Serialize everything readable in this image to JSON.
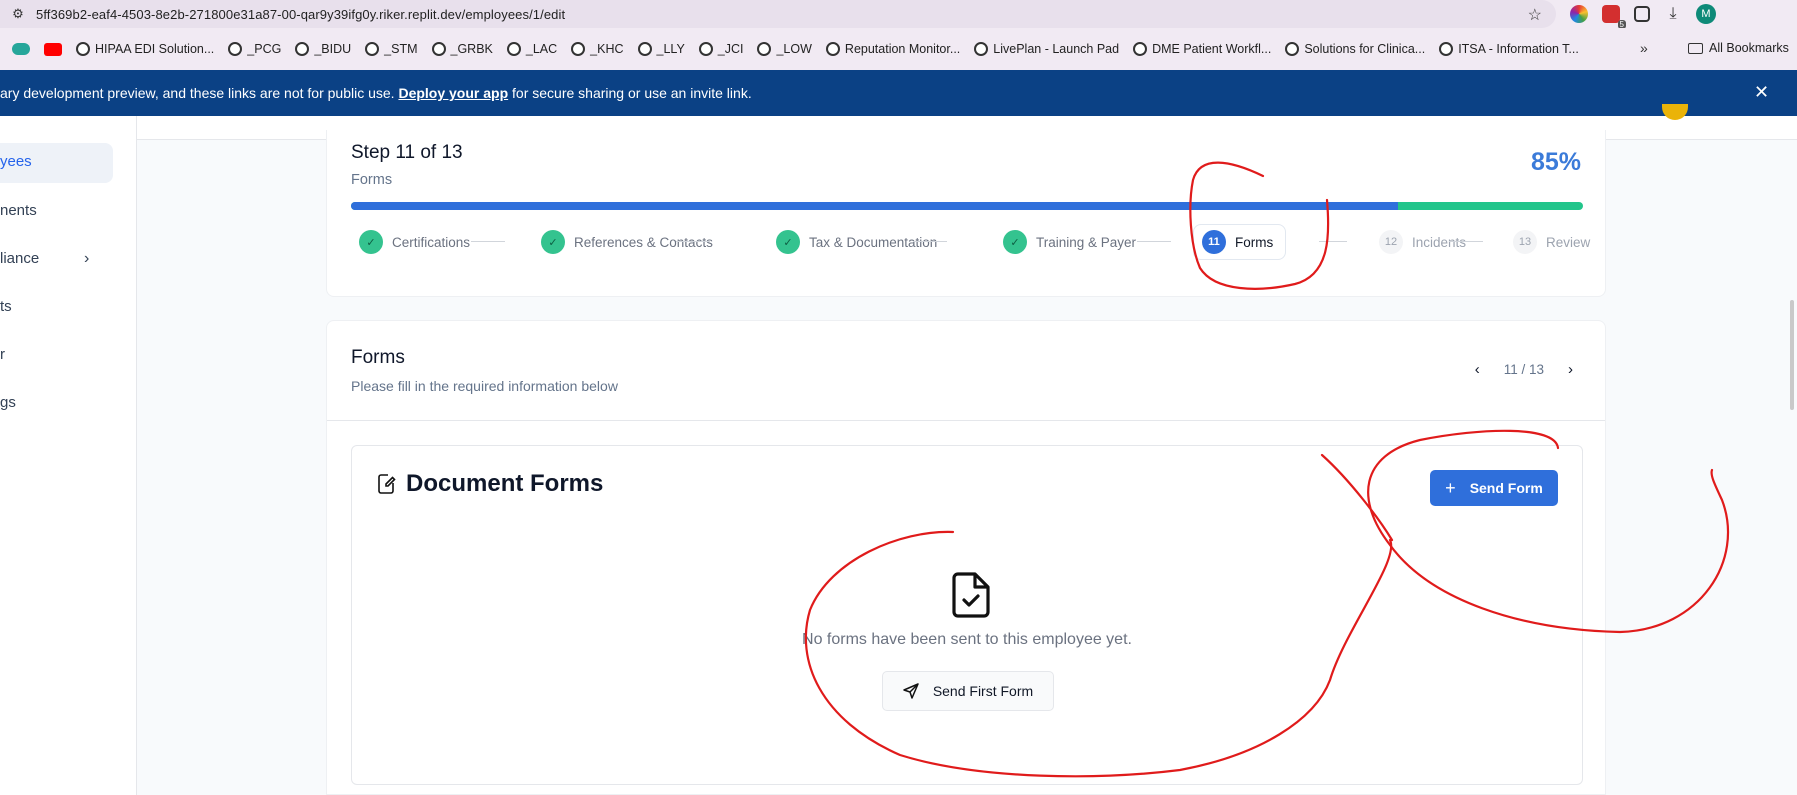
{
  "browser": {
    "url": "5ff369b2-eaf4-4503-8e2b-271800e31a87-00-qar9y39ifg0y.riker.replit.dev/employees/1/edit",
    "profile_initial": "M",
    "extension_badge": "5",
    "bookmarks": [
      {
        "label": "HIPAA EDI Solution..."
      },
      {
        "label": "_PCG"
      },
      {
        "label": "_BIDU"
      },
      {
        "label": "_STM"
      },
      {
        "label": "_GRBK"
      },
      {
        "label": "_LAC"
      },
      {
        "label": "_KHC"
      },
      {
        "label": "_LLY"
      },
      {
        "label": "_JCI"
      },
      {
        "label": "_LOW"
      },
      {
        "label": "Reputation Monitor..."
      },
      {
        "label": "LivePlan - Launch Pad"
      },
      {
        "label": "DME Patient Workfl..."
      },
      {
        "label": "Solutions for Clinica..."
      },
      {
        "label": "ITSA - Information T..."
      }
    ],
    "more_label": "»",
    "all_bookmarks_label": "All Bookmarks"
  },
  "banner": {
    "text_before": "ary development preview, and these links are not for public use. ",
    "link": "Deploy your app",
    "text_after": " for secure sharing or use an invite link.",
    "close": "✕"
  },
  "sidebar": {
    "items": [
      {
        "label": "yees"
      },
      {
        "label": "nents"
      },
      {
        "label": "liance"
      },
      {
        "label": "ts"
      },
      {
        "label": "r"
      },
      {
        "label": "gs"
      }
    ]
  },
  "step": {
    "title": "Step 11 of 13",
    "subtitle": "Forms",
    "percent": "85%",
    "progress_fraction": 0.85,
    "steps": [
      {
        "num": "✓",
        "label": "Certifications",
        "status": "done"
      },
      {
        "num": "✓",
        "label": "References & Contacts",
        "status": "done"
      },
      {
        "num": "✓",
        "label": "Tax & Documentation",
        "status": "done"
      },
      {
        "num": "✓",
        "label": "Training & Payer",
        "status": "done"
      },
      {
        "num": "11",
        "label": "Forms",
        "status": "active"
      },
      {
        "num": "12",
        "label": "Incidents",
        "status": "pending"
      },
      {
        "num": "13",
        "label": "Review",
        "status": "pending"
      }
    ]
  },
  "forms": {
    "title": "Forms",
    "subtitle": "Please fill in the required information below",
    "pager": "11 / 13",
    "panel_title": "Document Forms",
    "send_form_label": "Send Form",
    "empty_text": "No forms have been sent to this employee yet.",
    "send_first_label": "Send First Form"
  },
  "colors": {
    "primary": "#2f6fdb",
    "success": "#22c58b",
    "banner": "#0b4185",
    "annotation": "#e01b1b"
  }
}
